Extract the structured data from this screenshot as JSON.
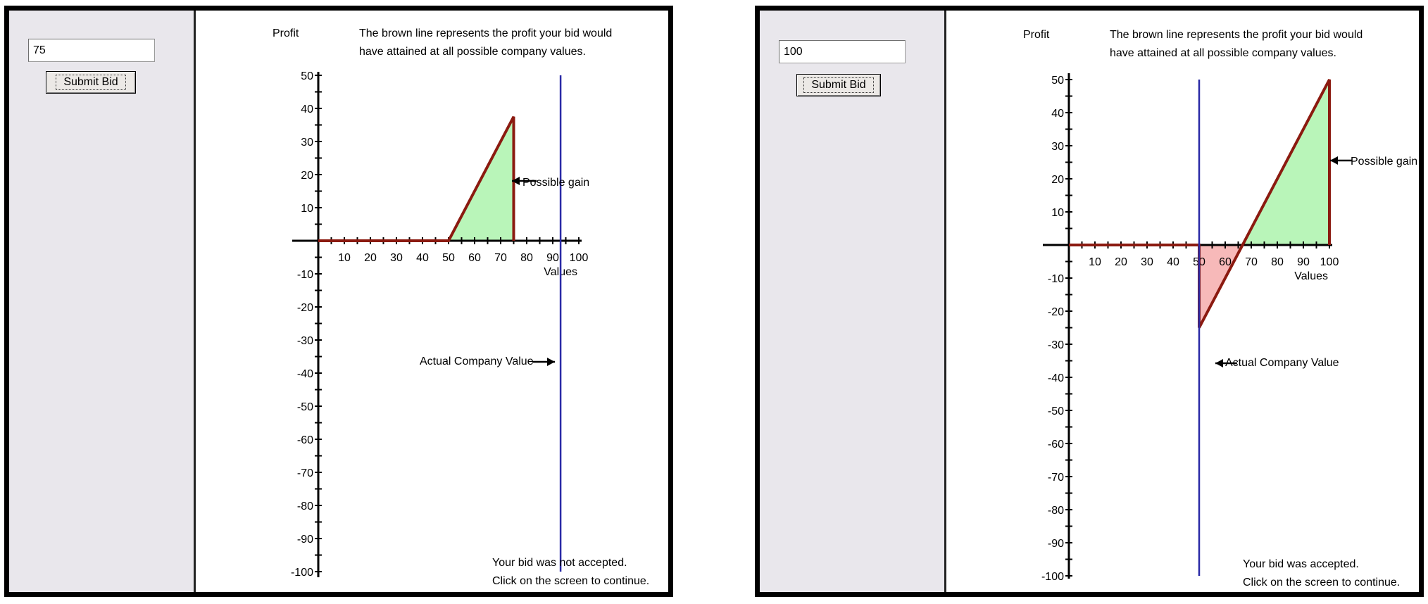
{
  "panels": [
    {
      "bid_value": "75",
      "submit_label": "Submit Bid",
      "y_axis_label": "Profit",
      "x_axis_label": "Values",
      "explanation_line1": "The brown line represents the profit your bid would",
      "explanation_line2": "have attained at all possible company values.",
      "possible_gain_label": "Possible gain",
      "actual_value_label": "Actual Company Value",
      "actual_value_arrow_direction": "right",
      "status_line1": "Your bid was not accepted.",
      "status_line2": "Click on the screen to continue.",
      "chart_data": {
        "type": "line",
        "x_ticks": [
          10,
          20,
          30,
          40,
          50,
          60,
          70,
          80,
          90,
          100
        ],
        "y_ticks": [
          50,
          40,
          30,
          20,
          10,
          -10,
          -20,
          -30,
          -40,
          -50,
          -60,
          -70,
          -80,
          -90,
          -100
        ],
        "xlim": [
          0,
          100
        ],
        "ylim": [
          -100,
          50
        ],
        "bid": 75,
        "actual_company_value": 93,
        "profit_line": [
          [
            0,
            0
          ],
          [
            50,
            0
          ],
          [
            75,
            37.5
          ],
          [
            75,
            0
          ]
        ],
        "gain_region": [
          [
            50,
            0
          ],
          [
            75,
            37.5
          ],
          [
            75,
            0
          ]
        ],
        "loss_region": []
      }
    },
    {
      "bid_value": "100",
      "submit_label": "Submit Bid",
      "y_axis_label": "Profit",
      "x_axis_label": "Values",
      "explanation_line1": "The brown line represents the profit your bid would",
      "explanation_line2": "have attained at all possible company values.",
      "possible_gain_label": "Possible gain",
      "actual_value_label": "Actual Company Value",
      "actual_value_arrow_direction": "left",
      "status_line1": "Your bid was accepted.",
      "status_line2": "Click on the screen to continue.",
      "chart_data": {
        "type": "line",
        "x_ticks": [
          10,
          20,
          30,
          40,
          50,
          60,
          70,
          80,
          90,
          100
        ],
        "y_ticks": [
          50,
          40,
          30,
          20,
          10,
          -10,
          -20,
          -30,
          -40,
          -50,
          -60,
          -70,
          -80,
          -90,
          -100
        ],
        "xlim": [
          0,
          100
        ],
        "ylim": [
          -100,
          50
        ],
        "bid": 100,
        "actual_company_value": 50,
        "profit_line": [
          [
            0,
            0
          ],
          [
            50,
            0
          ],
          [
            50,
            -25
          ],
          [
            100,
            50
          ],
          [
            100,
            0
          ]
        ],
        "gain_region": [
          [
            66.7,
            0
          ],
          [
            100,
            50
          ],
          [
            100,
            0
          ]
        ],
        "loss_region": [
          [
            50,
            0
          ],
          [
            50,
            -25
          ],
          [
            66.7,
            0
          ]
        ]
      }
    }
  ],
  "colors": {
    "profit_line": "#8b1a10",
    "gain_fill": "#b9f5b9",
    "loss_fill": "#f7b9b9",
    "actual_value_line": "#2a2aa6",
    "panel_background": "#e9e7ec",
    "frame": "#000000"
  }
}
